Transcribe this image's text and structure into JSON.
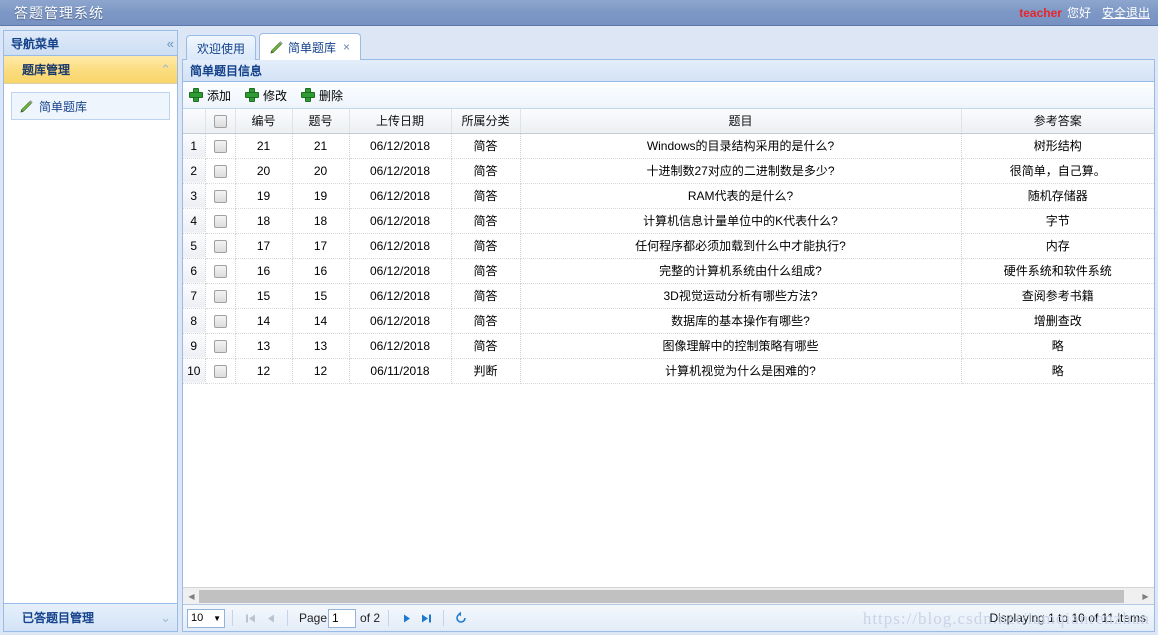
{
  "header": {
    "app_title": "答题管理系统",
    "user_name": "teacher",
    "greeting": "您好",
    "logout_label": "安全退出"
  },
  "sidebar": {
    "title": "导航菜单",
    "collapse_icon": "«",
    "groups": [
      {
        "label": "题库管理",
        "chevron": "⌃",
        "expanded": true,
        "items": [
          {
            "label": "简单题库",
            "icon": "pencil-icon"
          }
        ]
      },
      {
        "label": "已答题目管理",
        "chevron": "⌄",
        "expanded": false,
        "items": []
      }
    ]
  },
  "tabs": [
    {
      "label": "欢迎使用",
      "active": false,
      "closable": false
    },
    {
      "label": "简单题库",
      "active": true,
      "closable": true,
      "close_label": "×",
      "icon": "pencil-icon"
    }
  ],
  "panel": {
    "title": "简单题目信息",
    "toolbar": [
      {
        "label": "添加",
        "icon": "plus-icon"
      },
      {
        "label": "修改",
        "icon": "plus-icon"
      },
      {
        "label": "删除",
        "icon": "plus-icon"
      }
    ]
  },
  "grid": {
    "columns": [
      "",
      "",
      "编号",
      "题号",
      "上传日期",
      "所属分类",
      "题目",
      "参考答案"
    ],
    "rows": [
      {
        "n": "1",
        "id": "21",
        "qno": "21",
        "date": "06/12/2018",
        "cat": "简答",
        "q": "Windows的目录结构采用的是什么?",
        "a": "树形结构"
      },
      {
        "n": "2",
        "id": "20",
        "qno": "20",
        "date": "06/12/2018",
        "cat": "简答",
        "q": "十进制数27对应的二进制数是多少?",
        "a": "很简单，自己算。"
      },
      {
        "n": "3",
        "id": "19",
        "qno": "19",
        "date": "06/12/2018",
        "cat": "简答",
        "q": "RAM代表的是什么?",
        "a": "随机存储器"
      },
      {
        "n": "4",
        "id": "18",
        "qno": "18",
        "date": "06/12/2018",
        "cat": "简答",
        "q": "计算机信息计量单位中的K代表什么?",
        "a": "字节"
      },
      {
        "n": "5",
        "id": "17",
        "qno": "17",
        "date": "06/12/2018",
        "cat": "简答",
        "q": "任何程序都必须加载到什么中才能执行?",
        "a": "内存"
      },
      {
        "n": "6",
        "id": "16",
        "qno": "16",
        "date": "06/12/2018",
        "cat": "简答",
        "q": "完整的计算机系统由什么组成?",
        "a": "硬件系统和软件系统"
      },
      {
        "n": "7",
        "id": "15",
        "qno": "15",
        "date": "06/12/2018",
        "cat": "简答",
        "q": "3D视觉运动分析有哪些方法?",
        "a": "查阅参考书籍"
      },
      {
        "n": "8",
        "id": "14",
        "qno": "14",
        "date": "06/12/2018",
        "cat": "简答",
        "q": "数据库的基本操作有哪些?",
        "a": "增删查改"
      },
      {
        "n": "9",
        "id": "13",
        "qno": "13",
        "date": "06/12/2018",
        "cat": "简答",
        "q": "图像理解中的控制策略有哪些",
        "a": "略"
      },
      {
        "n": "10",
        "id": "12",
        "qno": "12",
        "date": "06/11/2018",
        "cat": "判断",
        "q": "计算机视觉为什么是困难的?",
        "a": "略"
      }
    ]
  },
  "pager": {
    "page_size": "10",
    "page_size_caret": "▼",
    "page_label": "Page",
    "page_value": "1",
    "of_label": "of 2",
    "status": "Displaying 1 to 10 of 11 items"
  },
  "watermark": "https://blog.csdn.net/iamqianrenzhan"
}
